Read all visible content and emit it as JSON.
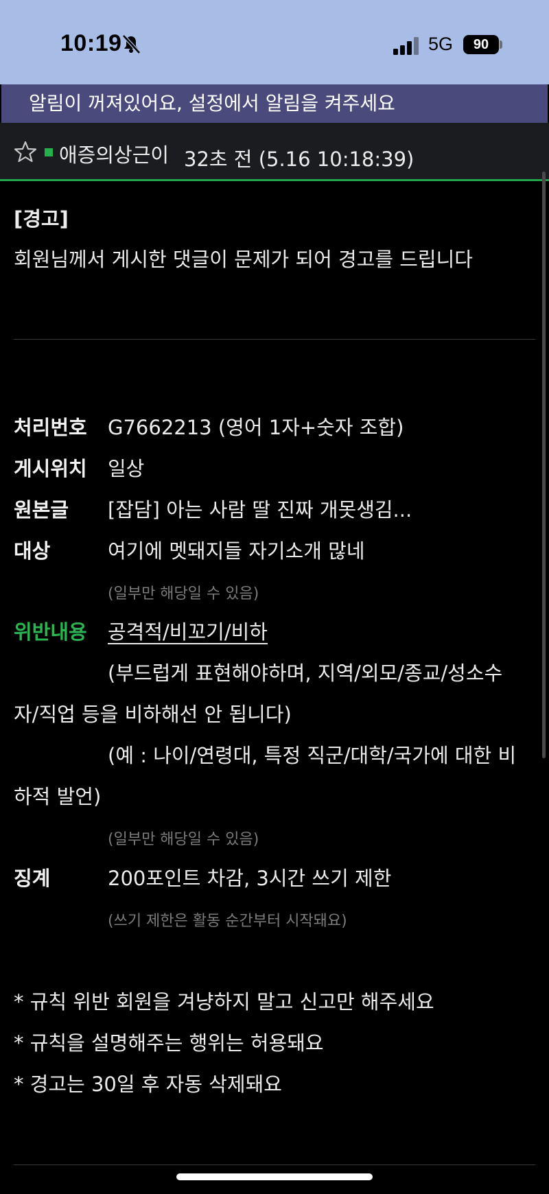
{
  "status_bar": {
    "time": "10:19",
    "network": "5G",
    "battery": "90",
    "icons": [
      "bell-slash-icon",
      "signal-icon"
    ]
  },
  "notice_banner": "알림이 꺼져있어요, 설정에서 알림을 켜주세요",
  "post": {
    "author": "애증의상근이",
    "time": "32초 전 (5.16 10:18:39)",
    "star_icon": "star-outline-icon"
  },
  "warning": {
    "title": "[경고]",
    "message": "회원님께서 게시한 댓글이 문제가 되어 경고를 드립니다"
  },
  "details": {
    "case_number_label": "처리번호",
    "case_number_value": "G7662213 (영어 1자+숫자 조합)",
    "location_label": "게시위치",
    "location_value": "일상",
    "original_label": "원본글",
    "original_value": "[잡담] 아는 사람 딸 진짜 개못생김...",
    "target_label": "대상",
    "target_value": "여기에 멧돼지들 자기소개 많네",
    "target_note": "(일부만 해당일 수 있음)",
    "violation_label": "위반내용",
    "violation_value": "공격적/비꼬기/비하",
    "violation_desc_line1": "(부드럽게 표현해야하며, 지역/외모/종교/성소수",
    "violation_desc_line2": "자/직업 등을 비하해선 안 됩니다)",
    "violation_example_line1": "(예 : 나이/연령대, 특정 직군/대학/국가에 대한 비",
    "violation_example_line2": "하적 발언)",
    "violation_note": "(일부만 해당일 수 있음)",
    "penalty_label": "징계",
    "penalty_value": "200포인트 차감, 3시간 쓰기 제한",
    "penalty_note": "(쓰기 제한은 활동 순간부터 시작돼요)"
  },
  "rules": [
    "* 규칙 위반 회원을 겨냥하지 말고 신고만 해주세요",
    "* 규칙을 설명해주는 행위는 허용돼요",
    "* 경고는 30일 후 자동 삭제돼요"
  ],
  "colors": {
    "status_bar_bg": "#a7bde6",
    "notice_bg": "#4a4b7c",
    "accent_green": "#27b34f",
    "background": "#000000"
  }
}
